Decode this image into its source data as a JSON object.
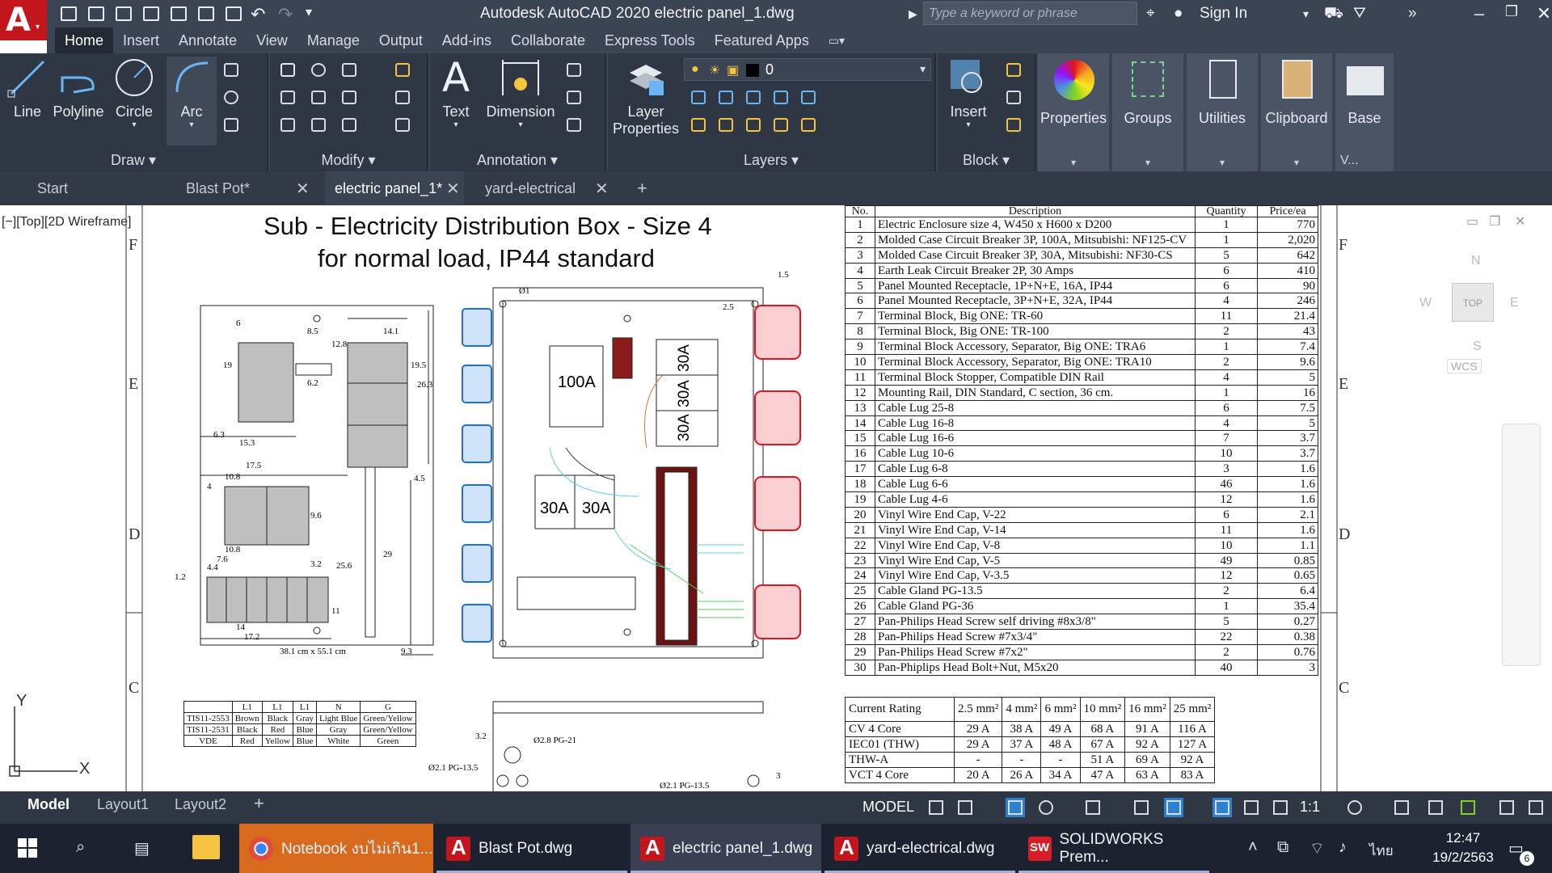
{
  "window": {
    "title": "Autodesk AutoCAD 2020    electric panel_1.dwg",
    "search_placeholder": "Type a keyword or phrase",
    "sign_in": "Sign In"
  },
  "ribbon_tabs": [
    "Home",
    "Insert",
    "Annotate",
    "View",
    "Manage",
    "Output",
    "Add-ins",
    "Collaborate",
    "Express Tools",
    "Featured Apps"
  ],
  "ribbon": {
    "draw": {
      "title": "Draw",
      "line": "Line",
      "polyline": "Polyline",
      "circle": "Circle",
      "arc": "Arc"
    },
    "modify": {
      "title": "Modify"
    },
    "annotation": {
      "title": "Annotation",
      "text": "Text",
      "dimension": "Dimension"
    },
    "layers": {
      "title": "Layers",
      "layer_properties_1": "Layer",
      "layer_properties_2": "Properties",
      "current_layer": "0"
    },
    "block": {
      "title": "Block",
      "insert": "Insert"
    },
    "properties": "Properties",
    "groups": "Groups",
    "utilities": "Utilities",
    "clipboard": "Clipboard",
    "base": "Base",
    "view_trunc": "V..."
  },
  "file_tabs": [
    {
      "label": "Start"
    },
    {
      "label": "Blast Pot*"
    },
    {
      "label": "electric panel_1*"
    },
    {
      "label": "yard-electrical"
    }
  ],
  "drawing": {
    "viewport_label": "[−][Top][2D Wireframe]",
    "title_line1": "Sub - Electricity Distribution Box - Size 4",
    "title_line2": "for normal load, IP44 standard",
    "sheet_letters_left": [
      "F",
      "E",
      "D",
      "C"
    ],
    "sheet_letters_right": [
      "F",
      "E",
      "D",
      "C"
    ],
    "enclosure_note": "38.1 cm x 55.1 cm",
    "breaker_labels": {
      "main": "100A",
      "b1": "30A",
      "b2": "30A",
      "b3": "30A",
      "b4": "30A",
      "b5": "30A"
    },
    "dims": [
      "6",
      "8.5",
      "12.8",
      "14.1",
      "19",
      "19.5",
      "26.3",
      "6.2",
      "6.3",
      "15.3",
      "17.5",
      "10.8",
      "4",
      "9.6",
      "10.8",
      "7.6",
      "4.4",
      "3.2",
      "25.6",
      "29",
      "4.5",
      "1.2",
      "11",
      "14",
      "17.2",
      "9.3",
      "1.5",
      "2.5",
      "Ø1"
    ],
    "lower_labels": {
      "d1": "3.2",
      "d2": "Ø2.8 PG-21",
      "d3": "Ø2.1 PG-13.5",
      "d4": "Ø2.1 PG-13.5",
      "d5": "3"
    },
    "bom_headers": [
      "No.",
      "Description",
      "Quantity",
      "Price/ea"
    ],
    "bom": [
      [
        "1",
        "Electric Enclosure size 4, W450 x H600 x D200",
        "1",
        "770"
      ],
      [
        "2",
        "Molded Case Circuit Breaker 3P, 100A, Mitsubishi: NF125-CV",
        "1",
        "2,020"
      ],
      [
        "3",
        "Molded Case Circuit Breaker 3P, 30A, Mitsubishi: NF30-CS",
        "5",
        "642"
      ],
      [
        "4",
        "Earth Leak Circuit Breaker 2P, 30 Amps",
        "6",
        "410"
      ],
      [
        "5",
        "Panel Mounted Receptacle, 1P+N+E, 16A, IP44",
        "6",
        "90"
      ],
      [
        "6",
        "Panel Mounted Receptacle, 3P+N+E, 32A, IP44",
        "4",
        "246"
      ],
      [
        "7",
        "Terminal Block, Big ONE: TR-60",
        "11",
        "21.4"
      ],
      [
        "8",
        "Terminal Block, Big ONE: TR-100",
        "2",
        "43"
      ],
      [
        "9",
        "Terminal Block Accessory, Separator, Big ONE: TRA6",
        "1",
        "7.4"
      ],
      [
        "10",
        "Terminal Block Accessory, Separator, Big ONE: TRA10",
        "2",
        "9.6"
      ],
      [
        "11",
        "Terminal Block Stopper, Compatible DIN Rail",
        "4",
        "5"
      ],
      [
        "12",
        "Mounting Rail, DIN Standard, C section, 36 cm.",
        "1",
        "16"
      ],
      [
        "13",
        "Cable Lug 25-8",
        "6",
        "7.5"
      ],
      [
        "14",
        "Cable Lug 16-8",
        "4",
        "5"
      ],
      [
        "15",
        "Cable Lug 16-6",
        "7",
        "3.7"
      ],
      [
        "16",
        "Cable Lug 10-6",
        "10",
        "3.7"
      ],
      [
        "17",
        "Cable Lug 6-8",
        "3",
        "1.6"
      ],
      [
        "18",
        "Cable Lug 6-6",
        "46",
        "1.6"
      ],
      [
        "19",
        "Cable Lug 4-6",
        "12",
        "1.6"
      ],
      [
        "20",
        "Vinyl Wire End Cap, V-22",
        "6",
        "2.1"
      ],
      [
        "21",
        "Vinyl Wire End Cap, V-14",
        "11",
        "1.6"
      ],
      [
        "22",
        "Vinyl Wire End Cap, V-8",
        "10",
        "1.1"
      ],
      [
        "23",
        "Vinyl Wire End Cap, V-5",
        "49",
        "0.85"
      ],
      [
        "24",
        "Vinyl Wire End Cap, V-3.5",
        "12",
        "0.65"
      ],
      [
        "25",
        "Cable Gland PG-13.5",
        "2",
        "6.4"
      ],
      [
        "26",
        "Cable Gland PG-36",
        "1",
        "35.4"
      ],
      [
        "27",
        "Pan-Philips Head Screw self driving #8x3/8\"",
        "5",
        "0.27"
      ],
      [
        "28",
        "Pan-Philips Head Screw #7x3/4\"",
        "22",
        "0.38"
      ],
      [
        "29",
        "Pan-Philips Head Screw #7x2\"",
        "2",
        "0.76"
      ],
      [
        "30",
        "Pan-Phiplips Head Bolt+Nut, M5x20",
        "40",
        "3"
      ]
    ],
    "ampacity_header": [
      "Current Rating",
      "2.5 mm²",
      "4 mm²",
      "6 mm²",
      "10 mm²",
      "16 mm²",
      "25 mm²"
    ],
    "ampacity": [
      [
        "CV 4 Core",
        "29 A",
        "38 A",
        "49 A",
        "68 A",
        "91 A",
        "116 A"
      ],
      [
        "IEC01 (THW)",
        "29 A",
        "37 A",
        "48 A",
        "67 A",
        "92 A",
        "127 A"
      ],
      [
        "THW-A",
        "-",
        "-",
        "-",
        "51 A",
        "69 A",
        "92 A"
      ],
      [
        "VCT 4 Core",
        "20 A",
        "26 A",
        "34 A",
        "47 A",
        "63 A",
        "83 A"
      ]
    ],
    "wire_header": [
      "",
      "L1",
      "L1",
      "L1",
      "N",
      "G"
    ],
    "wire_rows": [
      [
        "TIS11-2553",
        "Brown",
        "Black",
        "Gray",
        "Light Blue",
        "Green/Yellow"
      ],
      [
        "TIS11-2531",
        "Black",
        "Red",
        "Blue",
        "Gray",
        "Green/Yellow"
      ],
      [
        "VDE",
        "Red",
        "Yellow",
        "Blue",
        "White",
        "Green"
      ]
    ],
    "viewcube": {
      "n": "N",
      "s": "S",
      "e": "E",
      "w": "W",
      "top": "TOP",
      "wcs": "WCS"
    },
    "ucs": {
      "x": "X",
      "y": "Y"
    }
  },
  "layout_tabs": [
    "Model",
    "Layout1",
    "Layout2"
  ],
  "status": {
    "model": "MODEL",
    "scale": "1:1"
  },
  "taskbar": {
    "apps": [
      {
        "label": "Notebook งบไม่เกิน1..."
      },
      {
        "label": "Blast Pot.dwg"
      },
      {
        "label": "electric panel_1.dwg"
      },
      {
        "label": "yard-electrical.dwg"
      },
      {
        "label": "SOLIDWORKS Prem..."
      }
    ],
    "lang": "ไทย",
    "time": "12:47",
    "date": "19/2/2563",
    "notif_count": "6"
  },
  "colors": {
    "accent_red": "#c3161c",
    "ribbon_bg": "#3b4453",
    "panel_bg": "#2f3745",
    "receptacle_blue": "#1c6fd8",
    "receptacle_red": "#e0141e"
  }
}
